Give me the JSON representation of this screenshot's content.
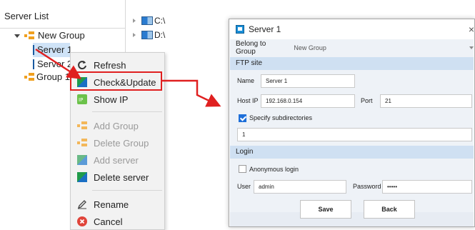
{
  "tree": {
    "header": "Server List",
    "items": [
      {
        "label": "New Group"
      },
      {
        "label": "Server 1"
      },
      {
        "label": "Server 2"
      },
      {
        "label": "Group 1"
      }
    ]
  },
  "drives": [
    {
      "label": "C:\\"
    },
    {
      "label": "D:\\"
    }
  ],
  "context_menu": {
    "items": [
      {
        "label": "Refresh",
        "icon": "refresh-icon",
        "enabled": true
      },
      {
        "label": "Check&Update",
        "icon": "check-update-icon",
        "enabled": true,
        "highlighted": true
      },
      {
        "label": "Show IP",
        "icon": "ip-icon",
        "enabled": true
      },
      {
        "label": "Add Group",
        "icon": "group-icon",
        "enabled": false
      },
      {
        "label": "Delete Group",
        "icon": "group-icon",
        "enabled": false
      },
      {
        "label": "Add server",
        "icon": "server-icon",
        "enabled": false
      },
      {
        "label": "Delete server",
        "icon": "server-icon",
        "enabled": true
      },
      {
        "label": "Rename",
        "icon": "pencil-icon",
        "enabled": true
      },
      {
        "label": "Cancel",
        "icon": "cancel-icon",
        "enabled": true
      }
    ]
  },
  "dialog": {
    "title": "Server 1",
    "close_glyph": "×",
    "belong_label": "Belong to Group",
    "belong_value": "New Group",
    "ftp_section": "FTP site",
    "name_label": "Name",
    "name_value": "Server 1",
    "host_label": "Host IP",
    "host_value": "192.168.0.154",
    "port_label": "Port",
    "port_value": "21",
    "specify_label": "Specify subdirectories",
    "specify_checked": true,
    "subdir_value": "1",
    "login_section": "Login",
    "anonymous_label": "Anonymous login",
    "anonymous_checked": false,
    "user_label": "User",
    "user_value": "admin",
    "password_label": "Password",
    "password_value": "•••••",
    "save_label": "Save",
    "back_label": "Back"
  },
  "colors": {
    "highlight": "#e02020",
    "section_header": "#cfe0f2",
    "accent": "#1e6fd9"
  }
}
